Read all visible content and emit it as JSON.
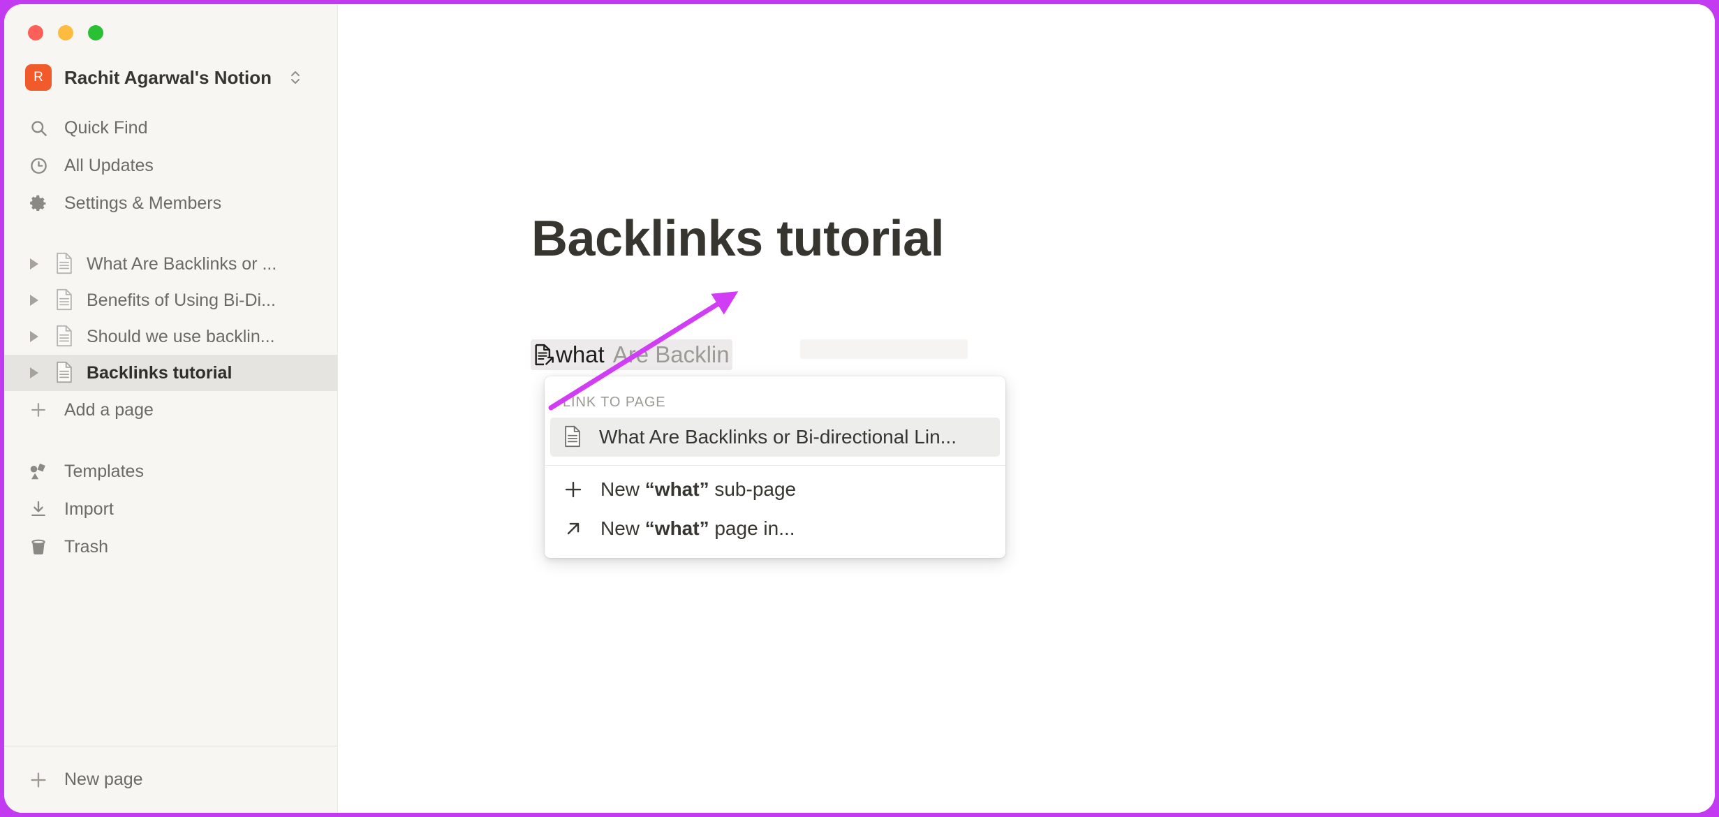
{
  "window": {
    "traffic_lights": [
      {
        "name": "close",
        "color": "#fc6058"
      },
      {
        "name": "minimize",
        "color": "#fdbc40"
      },
      {
        "name": "maximize",
        "color": "#2ac033"
      }
    ]
  },
  "sidebar": {
    "workspace": {
      "avatar_letter": "R",
      "avatar_color": "#f15a2b",
      "name": "Rachit Agarwal's Notion",
      "switcher_icon": "chevron-up-down-icon"
    },
    "nav_items": [
      {
        "label": "Quick Find",
        "icon": "search-icon"
      },
      {
        "label": "All Updates",
        "icon": "clock-icon"
      },
      {
        "label": "Settings & Members",
        "icon": "gear-icon"
      }
    ],
    "pages": [
      {
        "label": "What Are Backlinks or ...",
        "icon": "page-icon",
        "selected": false
      },
      {
        "label": "Benefits of Using Bi-Di...",
        "icon": "page-icon",
        "selected": false
      },
      {
        "label": "Should we use backlin...",
        "icon": "page-icon",
        "selected": false
      },
      {
        "label": "Backlinks tutorial",
        "icon": "page-icon",
        "selected": true
      }
    ],
    "add_page": {
      "label": "Add a page",
      "icon": "plus-icon"
    },
    "lower_items": [
      {
        "label": "Templates",
        "icon": "templates-icon"
      },
      {
        "label": "Import",
        "icon": "import-icon"
      },
      {
        "label": "Trash",
        "icon": "trash-icon"
      }
    ],
    "footer": {
      "label": "New page",
      "icon": "plus-icon"
    }
  },
  "main": {
    "page_title": "Backlinks tutorial",
    "inline_link": {
      "icon": "page-link-icon",
      "typed_text": "what",
      "suggestion_text": "Are Backlin"
    }
  },
  "link_menu": {
    "section_label": "LINK TO PAGE",
    "results": [
      {
        "label": "What Are Backlinks or Bi-directional Lin...",
        "icon": "page-icon",
        "highlighted": true
      }
    ],
    "actions": [
      {
        "label_prefix": "New ",
        "label_quoted": "“what”",
        "label_suffix": " sub-page",
        "icon": "plus-icon"
      },
      {
        "label_prefix": "New ",
        "label_quoted": "“what”",
        "label_suffix": " page in...",
        "icon": "arrow-up-right-icon"
      }
    ]
  },
  "annotation": {
    "arrow_color": "#d13cf5",
    "points_to": "link-menu-first-result"
  }
}
